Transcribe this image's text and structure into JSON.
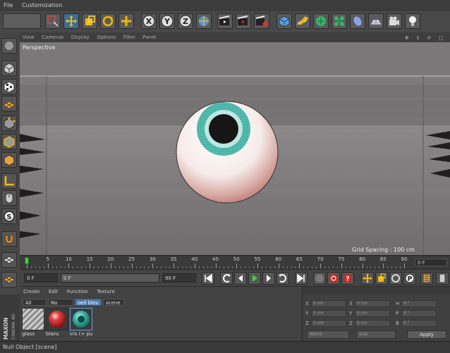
{
  "menu": {
    "items": [
      "File",
      "Customization"
    ]
  },
  "viewport_menu": {
    "items": [
      "View",
      "Cameras",
      "Display",
      "Options",
      "Filter",
      "Panel"
    ]
  },
  "viewport": {
    "label": "Perspective",
    "grid_spacing": "Grid Spacing : 100 cm"
  },
  "timeline": {
    "ticks": [
      "0",
      "5",
      "10",
      "15",
      "20",
      "25",
      "30",
      "35",
      "40",
      "45",
      "50",
      "55",
      "60",
      "65",
      "70",
      "75",
      "80",
      "85",
      "90"
    ],
    "current_frame": "0 F",
    "playhead_frame": 0
  },
  "transport": {
    "start_field": "0 F",
    "range_field": "0 F",
    "end_field": "90 F"
  },
  "materials": {
    "menu": [
      "Create",
      "Edit",
      "Function",
      "Texture"
    ],
    "tabs": [
      "All",
      "No Layer",
      "oeil bleu",
      "scene"
    ],
    "selected_tab": "oeil bleu",
    "items": [
      {
        "name": "glass",
        "kind": "striped"
      },
      {
        "name": "blanc",
        "kind": "red"
      },
      {
        "name": "iris (+ pu",
        "kind": "teal"
      }
    ]
  },
  "coordinates": {
    "rows": [
      {
        "a": "X",
        "av": "0 cm",
        "b": "X",
        "bv": "0 cm",
        "c": "H",
        "cv": "0 °"
      },
      {
        "a": "Y",
        "av": "0 cm",
        "b": "Y",
        "bv": "0 cm",
        "c": "P",
        "cv": "0 °"
      },
      {
        "a": "Z",
        "av": "0 cm",
        "b": "Z",
        "bv": "0 cm",
        "c": "B",
        "cv": "0 °"
      }
    ],
    "mode_dropdown": "World",
    "size_dropdown": "Size",
    "apply_label": "Apply"
  },
  "brand": {
    "line1": "MAXON",
    "line2": "CINEMA 4D"
  },
  "status": {
    "text": "Null Object [scene]"
  },
  "colors": {
    "selected_tab": "#4d79b4",
    "iris": "#4ab5a8",
    "viewport_bg": "#7c7a7a",
    "active_tool": "#3e6e94"
  }
}
